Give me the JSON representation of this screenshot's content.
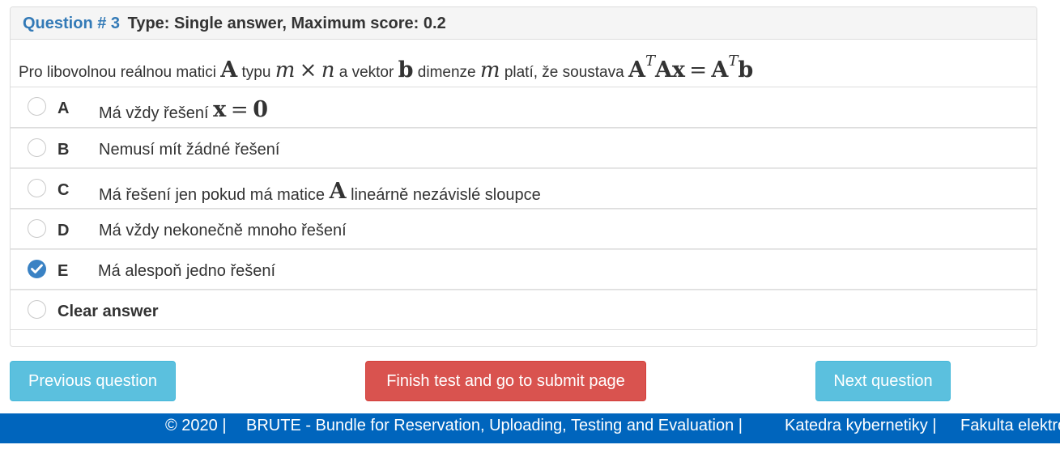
{
  "question": {
    "number_label": "Question # 3",
    "type_label": "Type: Single answer, Maximum score: 0.2",
    "text_parts": {
      "p1": "Pro libovolnou reálnou matici",
      "A": "A",
      "p2": "typu",
      "m": "m",
      "times": "×",
      "n": "n",
      "p3": "a vektor",
      "b": "b",
      "p4": "dimenze",
      "m2": "m",
      "p5": "platí, že soustava",
      "eq_A1": "A",
      "eq_T1": "T",
      "eq_Ax": "Ax",
      "eq_equals": "=",
      "eq_A2": "A",
      "eq_T2": "T",
      "eq_b": "b"
    }
  },
  "answers": [
    {
      "letter": "A",
      "text": "Má vždy řešení",
      "math_x": "x",
      "math_eq": "=",
      "math_0": "0",
      "selected": false
    },
    {
      "letter": "B",
      "text": "Nemusí mít žádné řešení",
      "selected": false
    },
    {
      "letter": "C",
      "text": "Má řešení jen pokud má matice",
      "math_A": "A",
      "text2": "lineárně nezávislé sloupce",
      "selected": false
    },
    {
      "letter": "D",
      "text": "Má vždy nekonečně mnoho řešení",
      "selected": false
    },
    {
      "letter": "E",
      "text": "Má alespoň jedno řešení",
      "selected": true
    }
  ],
  "clear_answer_label": "Clear answer",
  "buttons": {
    "previous": "Previous question",
    "finish": "Finish test and go to submit page",
    "next": "Next question"
  },
  "footer": {
    "copyright": "© 2020 |",
    "brute": "BRUTE - Bundle for Reservation, Uploading, Testing and Evaluation |",
    "katedra": "Katedra kybernetiky |",
    "fakulta": "Fakulta elektrotechnická"
  },
  "colors": {
    "accent": "#337ab7",
    "selected_radio": "#3a82c4",
    "info_button": "#5bc0de",
    "danger_button": "#d9534f",
    "footer_bg": "#0065bd"
  },
  "icons": {
    "selected_radio": "check-circle-icon",
    "unselected_radio": "empty-circle-icon"
  }
}
